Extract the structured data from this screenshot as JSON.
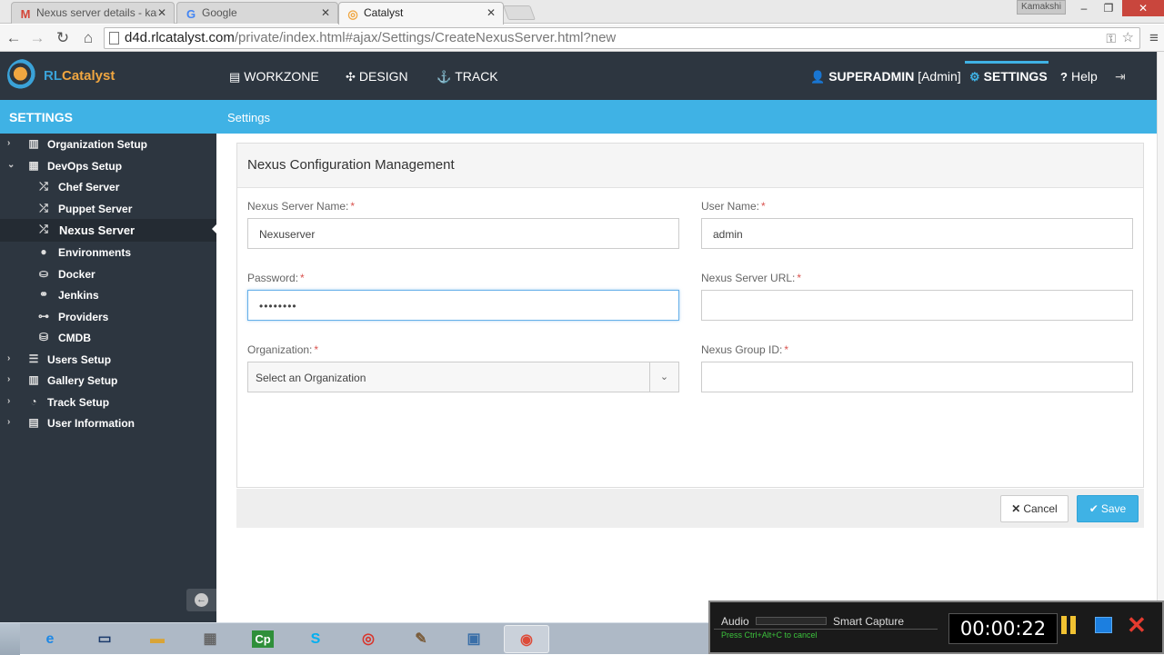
{
  "browser": {
    "tabs": [
      {
        "label": "Nexus server details - kam",
        "icon": "gmail-icon",
        "active": false
      },
      {
        "label": "Google",
        "icon": "google-icon",
        "active": false
      },
      {
        "label": "Catalyst",
        "icon": "catalyst-icon",
        "active": true
      }
    ],
    "window_user": "Kamakshi",
    "url_host": "d4d.rlcatalyst.com",
    "url_path": "/private/index.html#ajax/Settings/CreateNexusServer.html?new"
  },
  "header": {
    "logo_prefix": "RL",
    "logo_suffix": "Catalyst",
    "nav": [
      {
        "label": "WORKZONE",
        "icon": "workzone-icon"
      },
      {
        "label": "DESIGN",
        "icon": "design-icon"
      },
      {
        "label": "TRACK",
        "icon": "anchor-icon"
      }
    ],
    "user": "SUPERADMIN",
    "role": "[Admin]",
    "settings": "SETTINGS",
    "help": "Help"
  },
  "sidebar": {
    "title": "SETTINGS",
    "items": [
      {
        "label": "Organization Setup",
        "icon": "building-icon",
        "level": 0,
        "caret": "›"
      },
      {
        "label": "DevOps Setup",
        "icon": "grid-icon",
        "level": 0,
        "caret": "⌄"
      },
      {
        "label": "Chef Server",
        "icon": "shuffle-icon",
        "level": 1
      },
      {
        "label": "Puppet Server",
        "icon": "shuffle-icon",
        "level": 1
      },
      {
        "label": "Nexus Server",
        "icon": "shuffle-icon",
        "level": 1,
        "active": true
      },
      {
        "label": "Environments",
        "icon": "drop-icon",
        "level": 1
      },
      {
        "label": "Docker",
        "icon": "docker-icon",
        "level": 1
      },
      {
        "label": "Jenkins",
        "icon": "jenkins-icon",
        "level": 1
      },
      {
        "label": "Providers",
        "icon": "sitemap-icon",
        "level": 1
      },
      {
        "label": "CMDB",
        "icon": "database-icon",
        "level": 1
      },
      {
        "label": "Users Setup",
        "icon": "users-icon",
        "level": 0,
        "caret": "›"
      },
      {
        "label": "Gallery Setup",
        "icon": "gallery-icon",
        "level": 0,
        "caret": "›"
      },
      {
        "label": "Track Setup",
        "icon": "dashboard-icon",
        "level": 0,
        "caret": "›"
      },
      {
        "label": "User Information",
        "icon": "book-icon",
        "level": 0,
        "caret": "›"
      }
    ]
  },
  "breadcrumb": "Settings",
  "form": {
    "title": "Nexus Configuration Management",
    "server_name_label": "Nexus Server Name:",
    "server_name_value": "Nexuserver",
    "username_label": "User Name:",
    "username_value": "admin",
    "password_label": "Password:",
    "password_value": "••••••••",
    "url_label": "Nexus Server URL:",
    "url_value": "",
    "org_label": "Organization:",
    "org_value": "Select an Organization",
    "group_label": "Nexus Group ID:",
    "group_value": "",
    "required_mark": "*",
    "cancel": "Cancel",
    "save": "Save"
  },
  "capture": {
    "audio": "Audio",
    "smart": "Smart Capture",
    "hint": "Press Ctrl+Alt+C to cancel",
    "timer": "00:00:22"
  },
  "colors": {
    "accent": "#3fb2e5",
    "header_bg": "#2d3640",
    "required": "#d9534f"
  }
}
